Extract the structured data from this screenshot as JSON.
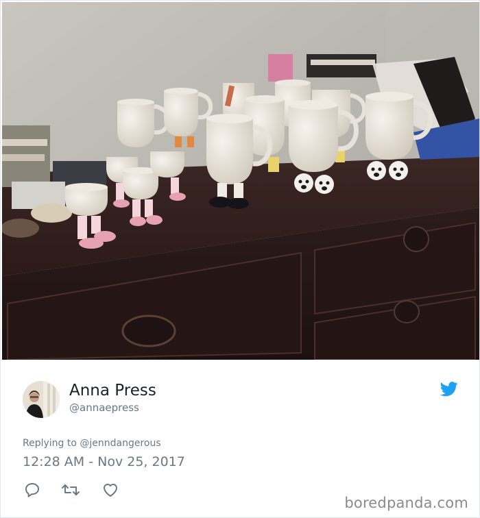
{
  "tweet": {
    "image": "photo of white ceramic mugs with little legs on a wooden dresser",
    "user": {
      "display_name": "Anna Press",
      "handle": "@annaepress",
      "avatar_icon": "avatar-photo"
    },
    "replying_to_prefix": "Replying to ",
    "replying_to": "@jenndangerous",
    "timestamp": "12:28 AM - Nov 25, 2017",
    "actions": [
      "reply-icon",
      "retweet-icon",
      "like-icon"
    ],
    "brand_icon": "twitter-bird-icon"
  },
  "watermark": "boredpanda.com",
  "colors": {
    "twitter_blue": "#1da1f2",
    "name": "#1c2022",
    "secondary": "#697882"
  }
}
